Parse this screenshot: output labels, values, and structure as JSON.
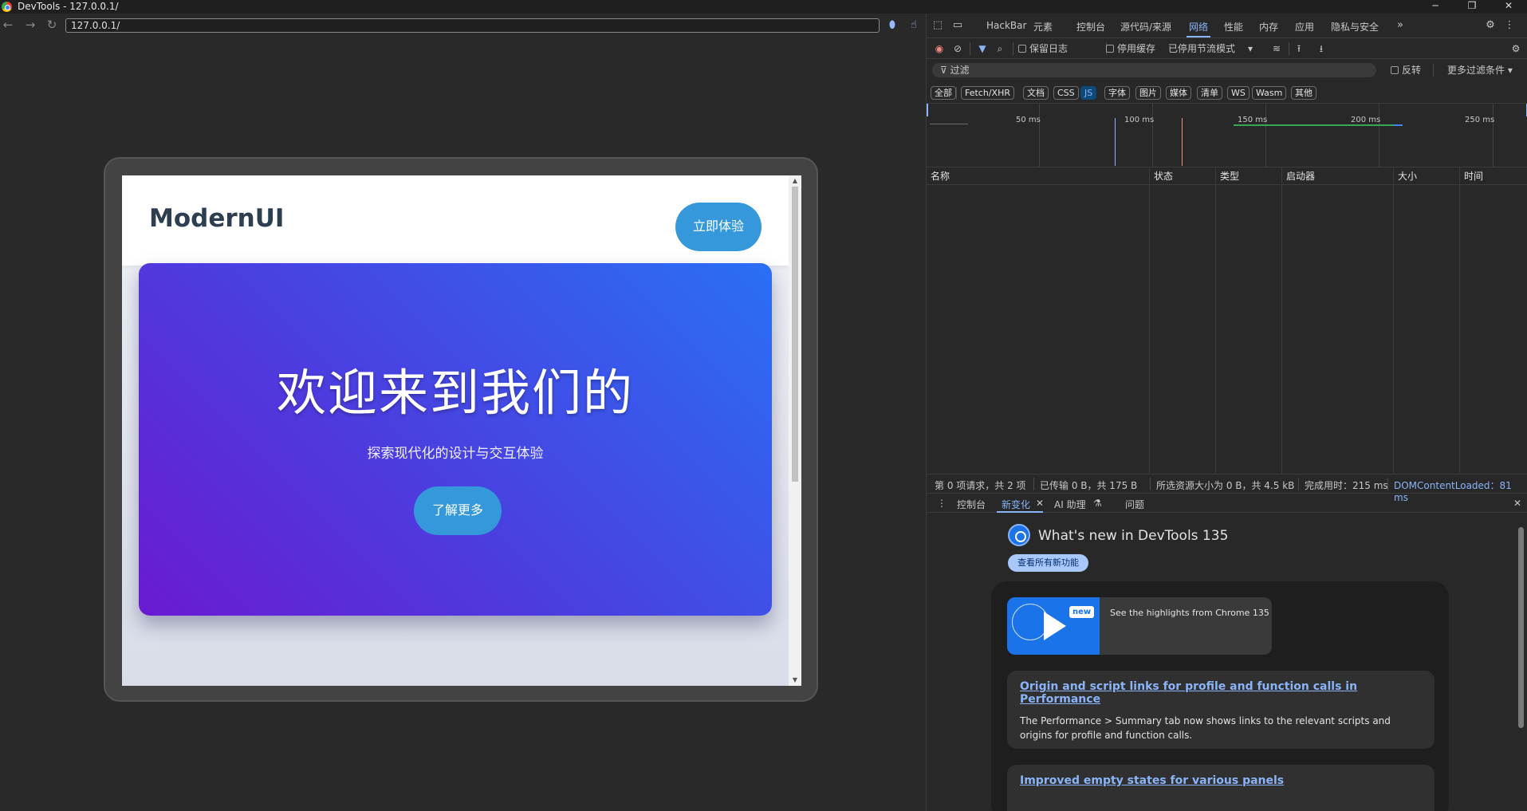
{
  "window": {
    "title": "DevTools - 127.0.0.1/",
    "controls": [
      "─",
      "❐",
      "✕"
    ]
  },
  "browser": {
    "url": "127.0.0.1/",
    "nav": {
      "back": "←",
      "forward": "→",
      "reload": "↻"
    }
  },
  "site": {
    "logo": "ModernUI",
    "header_button": "立即体验",
    "hero_title": "欢迎来到我们的",
    "hero_subtitle": "探索现代化的设计与交互体验",
    "hero_button": "了解更多"
  },
  "devtools": {
    "tabs": [
      "HackBar",
      "元素",
      "控制台",
      "源代码/来源",
      "网络",
      "性能",
      "内存",
      "应用",
      "隐私与安全"
    ],
    "active_tab": "网络",
    "more_tabs": "»",
    "toolbar": {
      "preserve_log": "保留日志",
      "disable_cache": "停用缓存",
      "throttle": "已停用节流模式"
    },
    "filter": {
      "placeholder": "过滤",
      "invert": "反转",
      "more_filters": "更多过滤条件 ▾"
    },
    "types": [
      "全部",
      "Fetch/XHR",
      "文档",
      "CSS",
      "JS",
      "字体",
      "图片",
      "媒体",
      "清单",
      "WS",
      "Wasm",
      "其他"
    ],
    "active_type": "JS",
    "timeline_ticks": [
      "50 ms",
      "100 ms",
      "150 ms",
      "200 ms",
      "250 ms"
    ],
    "columns": [
      "名称",
      "状态",
      "类型",
      "启动器",
      "大小",
      "时间"
    ],
    "status": {
      "requests": "第 0 项请求，共 2 项",
      "transferred": "已传输 0 B，共 175 B",
      "resources": "所选资源大小为 0 B，共 4.5 kB",
      "finish": "完成用时：215 ms",
      "dcl": "DOMContentLoaded：81 ms"
    },
    "drawer_tabs": [
      "控制台",
      "新变化",
      "AI 助理",
      "问题"
    ],
    "active_drawer_tab": "新变化",
    "whats_new": {
      "title": "What's new in DevTools 135",
      "all_button": "查看所有新功能",
      "video_badge": "new",
      "video_text": "See the highlights from Chrome 135",
      "items": [
        {
          "title": "Origin and script links for profile and function calls in Performance",
          "desc": "The Performance > Summary tab now shows links to the relevant scripts and origins for profile and function calls."
        },
        {
          "title": "Improved empty states for various panels",
          "desc": ""
        }
      ]
    }
  }
}
